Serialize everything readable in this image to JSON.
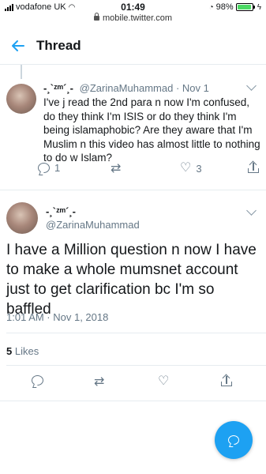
{
  "status_bar": {
    "carrier": "vodafone UK",
    "time": "01:49",
    "battery": "98%",
    "battery_level": 0.98,
    "url": "mobile.twitter.com"
  },
  "header": {
    "title": "Thread"
  },
  "tweet1": {
    "display_name": "-¸`ᶻᵐ´¸-",
    "handle": "@ZarinaMuhammad",
    "date": "Nov 1",
    "text": "I've j read the 2nd para n now I'm confused, do they think I'm ISIS or do they think I'm being islamaphobic? Are they aware that I'm Muslim n this video has almost little to nothing to do w Islam?",
    "reply_count": "1",
    "like_count": "3"
  },
  "tweet2": {
    "display_name": "-¸`ᶻᵐ´¸-",
    "handle": "@ZarinaMuhammad",
    "text": "I have a Million question n now I have to make a whole mumsnet account just to get clarification bc I'm so baffled",
    "timestamp": "1:01 AM · Nov 1, 2018",
    "likes_count": "5",
    "likes_label": "Likes"
  },
  "colors": {
    "accent": "#1da1f2",
    "secondary_text": "#657786",
    "divider": "#e6ecf0"
  },
  "icons": [
    "back-arrow-icon",
    "reply-icon",
    "retweet-icon",
    "like-icon",
    "share-icon",
    "chevron-down-icon",
    "compose-reply-icon"
  ]
}
